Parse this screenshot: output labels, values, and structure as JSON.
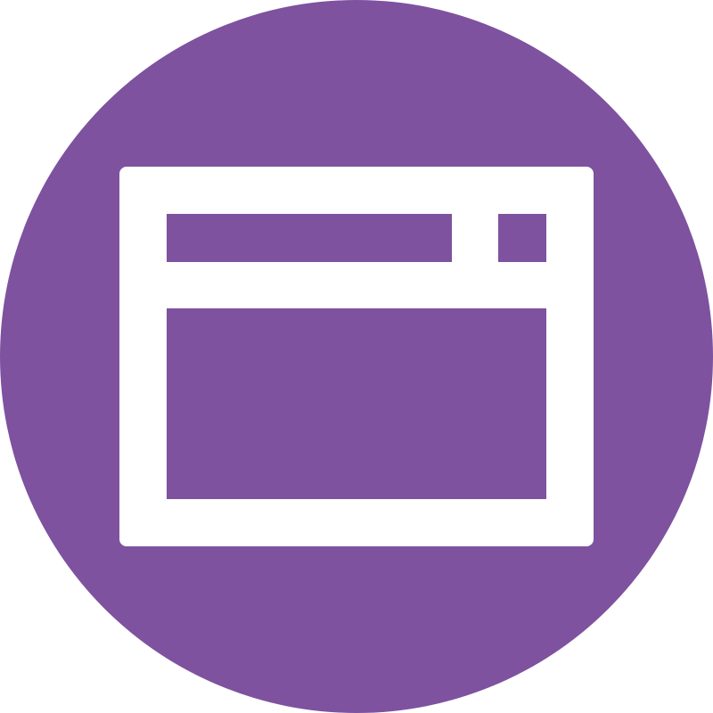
{
  "icon": {
    "name": "browser-window-icon",
    "description_color_background": "#7e529f",
    "description_color_foreground": "#ffffff"
  }
}
